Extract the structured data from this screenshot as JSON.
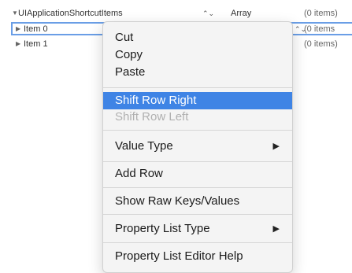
{
  "plist": {
    "rows": [
      {
        "key": "UIApplicationShortcutItems",
        "type": "Array",
        "value": "(0 items)"
      },
      {
        "key": "Item 0",
        "value": "(0 items"
      },
      {
        "key": "Item 1",
        "value": "(0 items)"
      }
    ]
  },
  "menu": {
    "items": {
      "cut": "Cut",
      "copy": "Copy",
      "paste": "Paste",
      "shift_right": "Shift Row Right",
      "shift_left": "Shift Row Left",
      "value_type": "Value Type",
      "add_row": "Add Row",
      "show_raw": "Show Raw Keys/Values",
      "plist_type": "Property List Type",
      "help": "Property List Editor Help"
    },
    "highlight_color": "#3f84e5"
  }
}
